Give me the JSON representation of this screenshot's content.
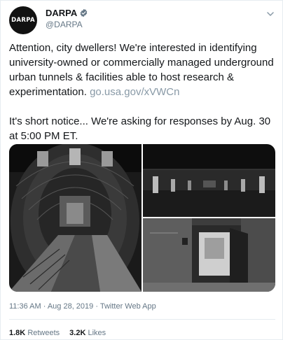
{
  "tweet": {
    "avatar_text": "DARPA",
    "display_name": "DARPA",
    "handle": "@DARPA",
    "verified": true,
    "text_p1": "Attention, city dwellers! We're interested in identifying university-owned or commercially managed underground urban tunnels & facilities able to host research & experimentation.",
    "link": "go.usa.gov/xVWCn",
    "text_p2": "It's short notice... We're asking for responses by Aug. 30 at 5:00 PM ET.",
    "meta": "11:36 AM · Aug 28, 2019 · Twitter Web App",
    "retweets_count": "1.8K",
    "retweets_label": "Retweets",
    "likes_count": "3.2K",
    "likes_label": "Likes"
  },
  "colors": {
    "text": "#14171a",
    "muted": "#657786",
    "link": "#8899a6",
    "verified": "#657786"
  },
  "icons": [
    "verified-badge-icon",
    "chevron-down-icon"
  ]
}
